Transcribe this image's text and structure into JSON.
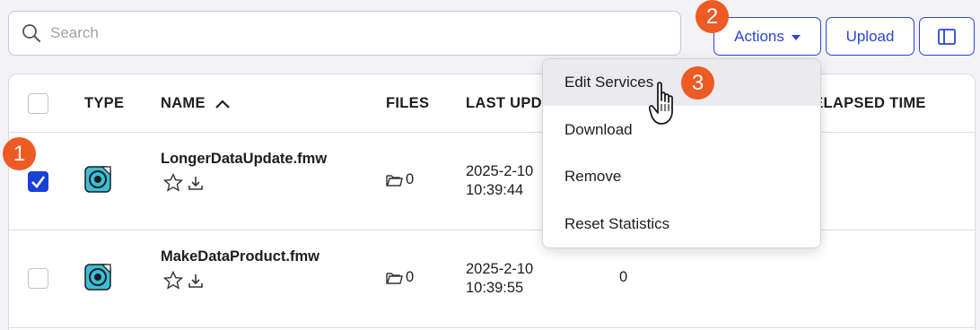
{
  "search": {
    "placeholder": "Search",
    "value": ""
  },
  "toolbar": {
    "actions_label": "Actions",
    "upload_label": "Upload"
  },
  "table": {
    "columns": {
      "type": "TYPE",
      "name": "NAME",
      "files": "FILES",
      "last_updated": "LAST UPD",
      "elapsed": "E ELAPSED TIME"
    },
    "rows": [
      {
        "name": "LongerDataUpdate.fmw",
        "files": "0",
        "updated_date": "2025-2-10",
        "updated_time": "10:39:44",
        "count": "",
        "selected": true
      },
      {
        "name": "MakeDataProduct.fmw",
        "files": "0",
        "updated_date": "2025-2-10",
        "updated_time": "10:39:55",
        "count": "0",
        "selected": false
      }
    ]
  },
  "actions_menu": {
    "items": [
      {
        "label": "Edit Services",
        "hovered": true
      },
      {
        "label": "Download",
        "hovered": false
      },
      {
        "label": "Remove",
        "hovered": false
      },
      {
        "label": "Reset Statistics",
        "hovered": false
      }
    ]
  },
  "callouts": [
    "1",
    "2",
    "3"
  ],
  "colors": {
    "accent": "#2a45d6",
    "checkbox": "#1a3fd8",
    "callout": "#ee5a24",
    "type_icon": "#3bbfd6"
  }
}
